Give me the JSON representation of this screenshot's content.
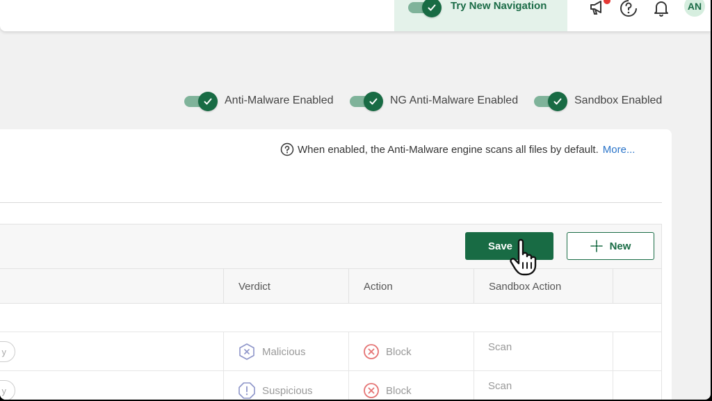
{
  "topbar": {
    "try_navigation_label": "Try New Navigation",
    "avatar_initials": "AN"
  },
  "toggles": [
    {
      "label": "Anti-Malware Enabled",
      "on": true
    },
    {
      "label": "NG Anti-Malware Enabled",
      "on": true
    },
    {
      "label": "Sandbox Enabled",
      "on": true
    }
  ],
  "info": {
    "text": "When enabled, the Anti-Malware engine scans all files by default.",
    "more_link": "More..."
  },
  "toolbar": {
    "save_label": "Save",
    "new_label": "New"
  },
  "table": {
    "columns": [
      "Verdict",
      "Action",
      "Sandbox Action"
    ],
    "rows": [
      {
        "pill": "y",
        "verdict": "Malicious",
        "verdict_icon": "hexagon-x-icon",
        "action": "Block",
        "action_icon": "circle-x-icon",
        "sandbox_action": "Scan"
      },
      {
        "pill": "y",
        "verdict": "Suspicious",
        "verdict_icon": "octagon-exclamation-icon",
        "action": "Block",
        "action_icon": "circle-x-icon",
        "sandbox_action": "Scan"
      }
    ]
  },
  "colors": {
    "brand_green": "#186b44",
    "toggle_track": "#7fb39a",
    "try_nav_bg": "#e4f2ea",
    "link_blue": "#2a74c9",
    "block_red": "#e57373",
    "verdict_purple": "#8e95c9"
  }
}
